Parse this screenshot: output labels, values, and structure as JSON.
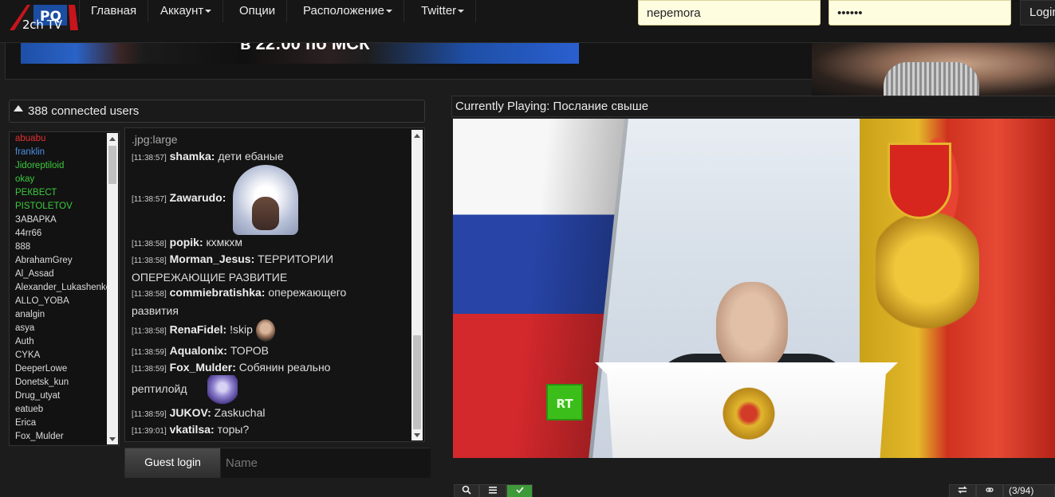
{
  "nav": {
    "logo_text": "2ch TV",
    "logo_badge": "PQ",
    "items": [
      {
        "label": "Главная",
        "dropdown": false
      },
      {
        "label": "Аккаунт",
        "dropdown": true
      },
      {
        "label": "Опции",
        "dropdown": false
      },
      {
        "label": "Расположение",
        "dropdown": true
      },
      {
        "label": "Twitter",
        "dropdown": true
      }
    ],
    "username_value": "nepemora",
    "password_value": "••••••",
    "login_label": "Login"
  },
  "banner": {
    "text": "в 22:00 по МСК"
  },
  "users": {
    "header": "388 connected users",
    "list": [
      {
        "name": "abuabu",
        "color": "#e03030"
      },
      {
        "name": "franklin",
        "color": "#4a8fe0"
      },
      {
        "name": "Jidoreptiloid",
        "color": "#3cc93c"
      },
      {
        "name": "okay",
        "color": "#3cc93c"
      },
      {
        "name": "РЕКВЕСТ",
        "color": "#3cc93c"
      },
      {
        "name": "PISTOLETOV",
        "color": "#3cc93c"
      },
      {
        "name": "ЗАВАРКА",
        "color": "#dddddd"
      },
      {
        "name": "44rr66",
        "color": "#dddddd"
      },
      {
        "name": "888",
        "color": "#dddddd"
      },
      {
        "name": "AbrahamGrey",
        "color": "#dddddd"
      },
      {
        "name": "Al_Assad",
        "color": "#dddddd"
      },
      {
        "name": "Alexander_Lukashenko",
        "color": "#dddddd"
      },
      {
        "name": "ALLO_YOBA",
        "color": "#dddddd"
      },
      {
        "name": "analgin",
        "color": "#dddddd"
      },
      {
        "name": "asya",
        "color": "#dddddd"
      },
      {
        "name": "Auth",
        "color": "#dddddd"
      },
      {
        "name": "CYKA",
        "color": "#dddddd"
      },
      {
        "name": "DeeperLowe",
        "color": "#dddddd"
      },
      {
        "name": "Donetsk_kun",
        "color": "#dddddd"
      },
      {
        "name": "Drug_utyat",
        "color": "#dddddd"
      },
      {
        "name": "eatueb",
        "color": "#dddddd"
      },
      {
        "name": "Erica",
        "color": "#dddddd"
      },
      {
        "name": "Fox_Mulder",
        "color": "#dddddd"
      }
    ]
  },
  "chat": {
    "partial_top": ".jpg:large",
    "messages": [
      {
        "time": "[11:38:57]",
        "nick": "shamka:",
        "text": "дети ебаные"
      },
      {
        "time": "[11:38:57]",
        "nick": "Zawarudo:",
        "text": ""
      },
      {
        "time": "[11:38:58]",
        "nick": "popik:",
        "text": "кхмкхм"
      },
      {
        "time": "[11:38:58]",
        "nick": "Morman_Jesus:",
        "text": "ТЕРРИТОРИИ",
        "text2": "ОПЕРЕЖАЮЩИЕ РАЗВИТИЕ"
      },
      {
        "time": "[11:38:58]",
        "nick": "commiebratishka:",
        "text": "опережающего",
        "text2": "развития"
      },
      {
        "time": "[11:38:58]",
        "nick": "RenaFidel:",
        "text": "!skip"
      },
      {
        "time": "[11:38:59]",
        "nick": "Aqualonix:",
        "text": "ТОРОВ"
      },
      {
        "time": "[11:38:59]",
        "nick": "Fox_Mulder:",
        "text": "Собянин реально",
        "text2": "рептилойд"
      },
      {
        "time": "[11:38:59]",
        "nick": "JUKOV:",
        "text": "Zaskuchal"
      },
      {
        "time": "[11:39:01]",
        "nick": "vkatilsa:",
        "text": "торы?"
      }
    ]
  },
  "guest": {
    "button_label": "Guest login",
    "name_placeholder": "Name"
  },
  "player": {
    "now_playing": "Currently Playing: Послание свыше",
    "channel_logo": "RT"
  },
  "toolbar": {
    "counter": "(3/94)"
  }
}
